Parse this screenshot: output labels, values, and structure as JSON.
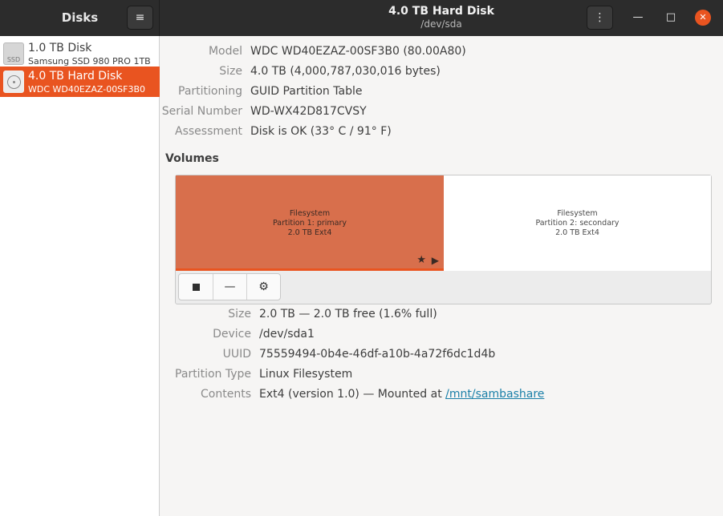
{
  "app": {
    "title": "Disks"
  },
  "window": {
    "title": "4.0 TB Hard Disk",
    "subtitle": "/dev/sda"
  },
  "header": {
    "menu_icon": "≡",
    "kebab_icon": "⋮",
    "min_icon": "—",
    "max_icon": "□",
    "close_icon": "✕"
  },
  "sidebar": {
    "items": [
      {
        "name": "1.0 TB Disk",
        "sub": "Samsung SSD 980 PRO 1TB",
        "icon": "ssd-icon",
        "badge": "SSD"
      },
      {
        "name": "4.0 TB Hard Disk",
        "sub": "WDC WD40EZAZ-00SF3B0",
        "icon": "hard-disk-icon"
      }
    ]
  },
  "drive": {
    "model_label": "Model",
    "model": "WDC WD40EZAZ-00SF3B0 (80.00A80)",
    "size_label": "Size",
    "size": "4.0 TB (4,000,787,030,016 bytes)",
    "partitioning_label": "Partitioning",
    "partitioning": "GUID Partition Table",
    "serial_label": "Serial Number",
    "serial": "WD-WX42D817CVSY",
    "assessment_label": "Assessment",
    "assessment": "Disk is OK (33° C / 91° F)"
  },
  "volumes": {
    "title": "Volumes",
    "partitions": [
      {
        "line1": "Filesystem",
        "line2": "Partition 1: primary",
        "line3": "2.0 TB Ext4"
      },
      {
        "line1": "Filesystem",
        "line2": "Partition 2: secondary",
        "line3": "2.0 TB Ext4"
      }
    ],
    "toolbar": {
      "stop_icon": "■",
      "minus_icon": "—",
      "gear_icon": "⚙"
    },
    "star_icon": "★",
    "play_icon": "▶"
  },
  "partition_details": {
    "size_label": "Size",
    "size": "2.0 TB — 2.0 TB free (1.6% full)",
    "device_label": "Device",
    "device": "/dev/sda1",
    "uuid_label": "UUID",
    "uuid": "75559494-0b4e-46df-a10b-4a72f6dc1d4b",
    "type_label": "Partition Type",
    "type": "Linux Filesystem",
    "contents_label": "Contents",
    "contents_prefix": "Ext4 (version 1.0) — Mounted at ",
    "mount_link": "/mnt/sambashare"
  },
  "colors": {
    "accent": "#e95420",
    "header_bg": "#2c2c2c",
    "link": "#1a7fa8"
  }
}
